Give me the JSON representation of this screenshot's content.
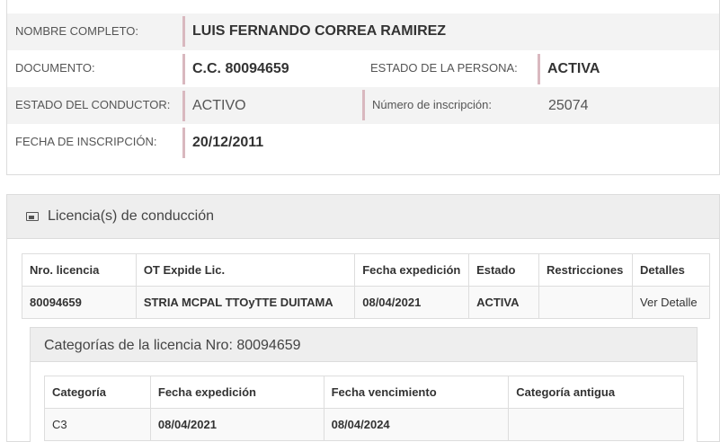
{
  "person": {
    "nombre_label": "NOMBRE COMPLETO:",
    "nombre_value": "LUIS FERNANDO CORREA RAMIREZ",
    "documento_label": "DOCUMENTO:",
    "documento_value": "C.C. 80094659",
    "estado_persona_label": "ESTADO DE LA PERSONA:",
    "estado_persona_value": "ACTIVA",
    "estado_conductor_label": "ESTADO DEL CONDUCTOR:",
    "estado_conductor_value": "ACTIVO",
    "inscripcion_num_label": "Número de inscripción:",
    "inscripcion_num_value": "25074",
    "fecha_inscripcion_label": "FECHA DE INSCRIPCIÓN:",
    "fecha_inscripcion_value": "20/12/2011"
  },
  "licenses": {
    "title": "Licencia(s) de conducción",
    "columns": [
      "Nro. licencia",
      "OT Expide Lic.",
      "Fecha expedición",
      "Estado",
      "Restricciones",
      "Detalles"
    ],
    "rows": [
      {
        "nro": "80094659",
        "ot": "STRIA MCPAL TTOyTTE DUITAMA",
        "fecha": "08/04/2021",
        "estado": "ACTIVA",
        "restricciones": "",
        "detalles": "Ver Detalle"
      }
    ]
  },
  "categories": {
    "title": "Categorías de la licencia Nro: 80094659",
    "columns": [
      "Categoría",
      "Fecha expedición",
      "Fecha vencimiento",
      "Categoría antigua"
    ],
    "rows": [
      {
        "categoria": "C3",
        "expedicion": "08/04/2021",
        "vencimiento": "08/04/2024",
        "antigua": ""
      }
    ]
  }
}
